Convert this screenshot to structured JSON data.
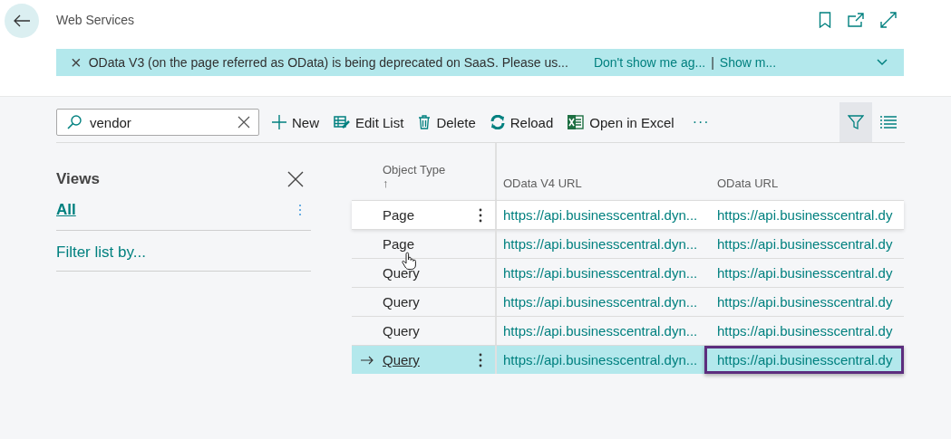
{
  "page": {
    "title": "Web Services"
  },
  "banner": {
    "close": "×",
    "message": "OData V3 (on the page referred as OData) is being deprecated on SaaS. Please us...",
    "link_1": "Don't show me ag...",
    "separator": "|",
    "link_2": "Show m..."
  },
  "search": {
    "value": "vendor"
  },
  "actions": [
    {
      "label": "New",
      "kind": "new"
    },
    {
      "label": "Edit List",
      "kind": "edit"
    },
    {
      "label": "Delete",
      "kind": "delete"
    },
    {
      "label": "Reload",
      "kind": "reload"
    },
    {
      "label": "Open in Excel",
      "kind": "excel"
    }
  ],
  "more_actions": "···",
  "filter_pane": {
    "on": true
  },
  "views": {
    "title": "Views",
    "items": [
      {
        "label": "All",
        "selected": true
      }
    ],
    "filter_link": "Filter list by..."
  },
  "table": {
    "columns": [
      {
        "label": "Object Type",
        "sort": "↑"
      },
      {
        "label": "OData V4 URL"
      },
      {
        "label": "OData URL"
      }
    ],
    "rows": [
      {
        "object_type": "Page",
        "v4_url": "https://api.businesscentral.dyn...",
        "odata_url": "https://api.businesscentral.dy",
        "selected": false,
        "hovered": true,
        "outlined": false
      },
      {
        "object_type": "Page",
        "v4_url": "https://api.businesscentral.dyn...",
        "odata_url": "https://api.businesscentral.dy",
        "selected": false,
        "hovered": false,
        "outlined": false
      },
      {
        "object_type": "Query",
        "v4_url": "https://api.businesscentral.dyn...",
        "odata_url": "https://api.businesscentral.dy",
        "selected": false,
        "hovered": false,
        "outlined": false
      },
      {
        "object_type": "Query",
        "v4_url": "https://api.businesscentral.dyn...",
        "odata_url": "https://api.businesscentral.dy",
        "selected": false,
        "hovered": false,
        "outlined": false
      },
      {
        "object_type": "Query",
        "v4_url": "https://api.businesscentral.dyn...",
        "odata_url": "https://api.businesscentral.dy",
        "selected": false,
        "hovered": false,
        "outlined": false
      },
      {
        "object_type": "Query",
        "v4_url": "https://api.businesscentral.dyn...",
        "odata_url": "https://api.businesscentral.dy",
        "selected": true,
        "hovered": false,
        "outlined": true
      }
    ]
  }
}
